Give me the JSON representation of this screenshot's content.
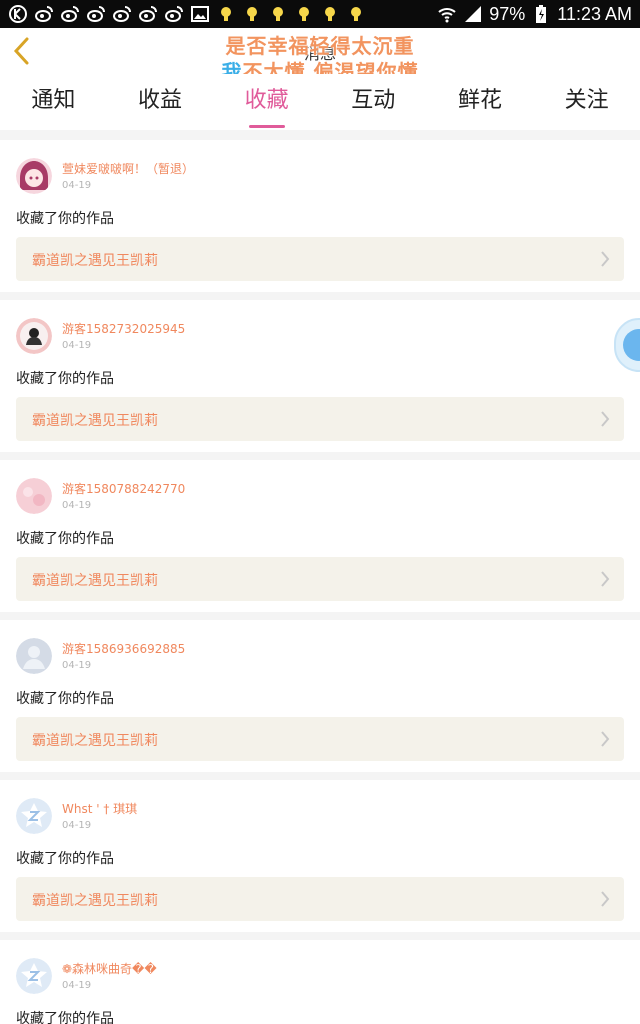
{
  "status_bar": {
    "left_icons": [
      "k-app-icon",
      "weibo-icon",
      "weibo-icon",
      "weibo-icon",
      "weibo-icon",
      "weibo-icon",
      "weibo-icon",
      "gallery-icon",
      "bulb-icon",
      "bulb-icon",
      "bulb-icon",
      "bulb-icon",
      "bulb-icon",
      "bulb-icon"
    ],
    "battery": "97%",
    "time": "11:23 AM"
  },
  "header": {
    "title": "消息",
    "overlay_line1": "是否幸福轻得太沉重",
    "overlay_line2_highlight": "我",
    "overlay_line2_rest": "不太懂 偏渴望你懂"
  },
  "tabs": [
    {
      "label": "通知",
      "active": false
    },
    {
      "label": "收益",
      "active": false
    },
    {
      "label": "收藏",
      "active": true
    },
    {
      "label": "互动",
      "active": false
    },
    {
      "label": "鲜花",
      "active": false
    },
    {
      "label": "关注",
      "active": false
    }
  ],
  "colors": {
    "accent": "#e05b9a",
    "name": "#f0885e",
    "work_bg": "#f4f2ea"
  },
  "items": [
    {
      "user": "萱妹爱啵啵啊！（暂退）",
      "date": "04-19",
      "action": "收藏了你的作品",
      "work": "霸道凯之遇见王凯莉",
      "avatar": "anime-girl-avatar"
    },
    {
      "user": "游客1582732025945",
      "date": "04-19",
      "action": "收藏了你的作品",
      "work": "霸道凯之遇见王凯莉",
      "avatar": "photo-avatar"
    },
    {
      "user": "游客1580788242770",
      "date": "04-19",
      "action": "收藏了你的作品",
      "work": "霸道凯之遇见王凯莉",
      "avatar": "pink-avatar"
    },
    {
      "user": "游客1586936692885",
      "date": "04-19",
      "action": "收藏了你的作品",
      "work": "霸道凯之遇见王凯莉",
      "avatar": "default-avatar"
    },
    {
      "user": "Whst ' † 琪琪",
      "date": "04-19",
      "action": "收藏了你的作品",
      "work": "霸道凯之遇见王凯莉",
      "avatar": "z-star-avatar"
    },
    {
      "user": "❁森林咪曲奇��",
      "date": "04-19",
      "action": "收藏了你的作品",
      "work": "",
      "avatar": "z-star-avatar"
    }
  ]
}
